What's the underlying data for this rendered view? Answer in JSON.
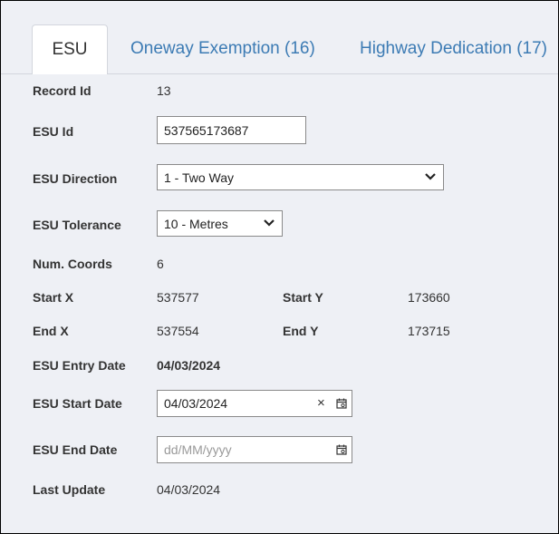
{
  "tabs": [
    {
      "label": "ESU",
      "active": true
    },
    {
      "label": "Oneway Exemption (16)",
      "active": false
    },
    {
      "label": "Highway Dedication (17)",
      "active": false
    }
  ],
  "record_id": {
    "label": "Record Id",
    "value": "13"
  },
  "esu_id": {
    "label": "ESU Id",
    "value": "537565173687"
  },
  "esu_direction": {
    "label": "ESU Direction",
    "selected": "1 - Two Way"
  },
  "esu_tolerance": {
    "label": "ESU Tolerance",
    "selected": "10 - Metres"
  },
  "num_coords": {
    "label": "Num. Coords",
    "value": "6"
  },
  "start_x": {
    "label": "Start X",
    "value": "537577"
  },
  "start_y": {
    "label": "Start Y",
    "value": "173660"
  },
  "end_x": {
    "label": "End X",
    "value": "537554"
  },
  "end_y": {
    "label": "End Y",
    "value": "173715"
  },
  "entry_date": {
    "label": "ESU Entry Date",
    "value": "04/03/2024"
  },
  "start_date": {
    "label": "ESU Start Date",
    "value": "04/03/2024",
    "clear_glyph": "×"
  },
  "end_date": {
    "label": "ESU End Date",
    "placeholder": "dd/MM/yyyy"
  },
  "last_update": {
    "label": "Last Update",
    "value": "04/03/2024"
  },
  "icons": {
    "dropdown": "chevron-down-icon",
    "calendar": "calendar-icon",
    "clear": "close-icon"
  },
  "colors": {
    "tab_link": "#3c7bb4",
    "background": "#eef0f5"
  }
}
